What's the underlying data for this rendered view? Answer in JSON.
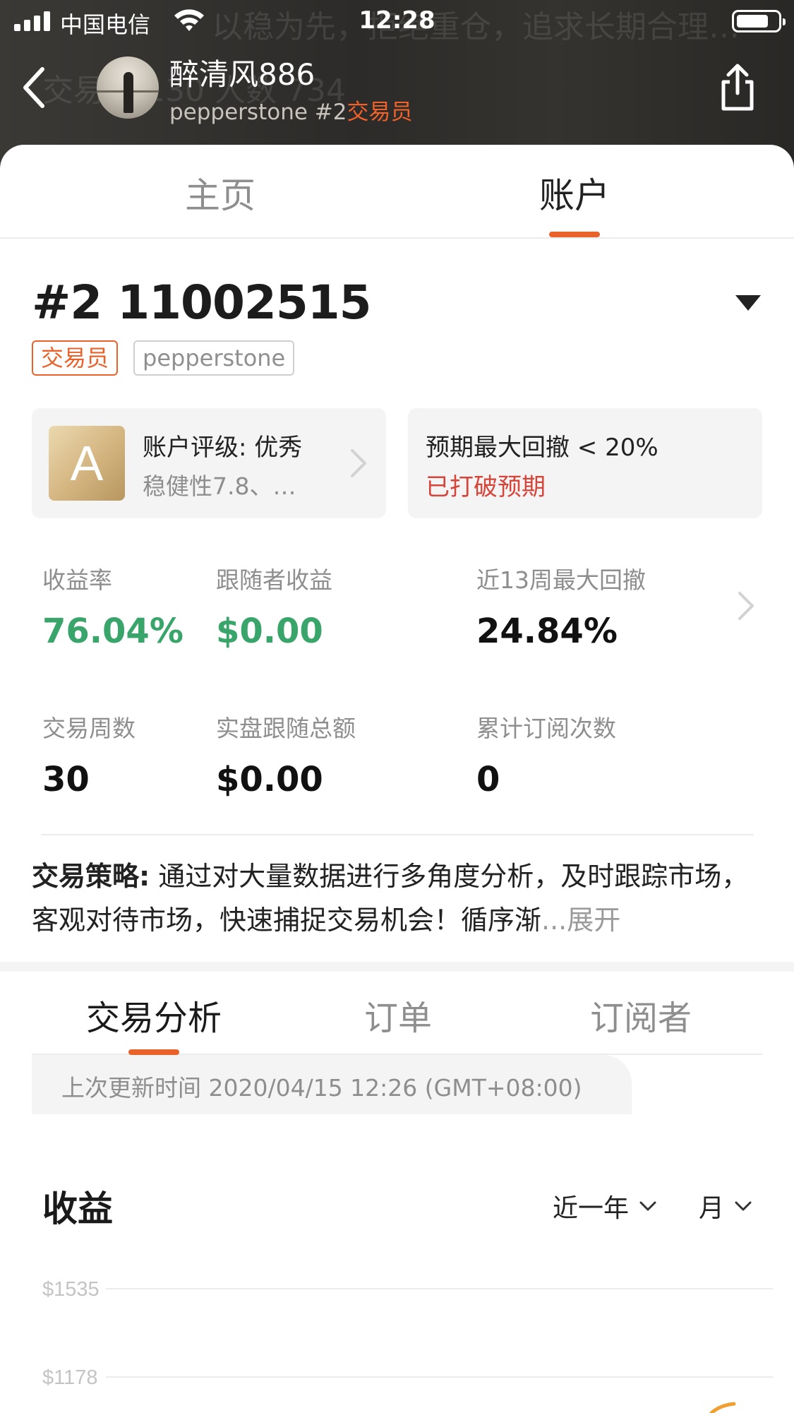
{
  "status_bar": {
    "carrier": "中国电信",
    "time": "12:28"
  },
  "header": {
    "user_name": "醉清风886",
    "broker": "pepperstone",
    "account_rank": "#2",
    "role": "交易员",
    "background_text": [
      "以稳为先，拒绝重仓，追求长期合理…",
      "交易量 130   人数 734"
    ]
  },
  "main_tabs": [
    {
      "label": "主页",
      "active": false
    },
    {
      "label": "账户",
      "active": true
    }
  ],
  "account": {
    "number": "#2 11002515",
    "badges": [
      "交易员",
      "pepperstone"
    ],
    "rating_card": {
      "grade": "A",
      "title": "账户评级: 优秀",
      "subtitle": "稳健性7.8、…"
    },
    "drawdown_card": {
      "title": "预期最大回撤 < 20%",
      "status": "已打破预期"
    },
    "stats": [
      {
        "label": "收益率",
        "value": "76.04%",
        "color": "#3aa56a"
      },
      {
        "label": "跟随者收益",
        "value": "$0.00",
        "color": "#3aa56a"
      },
      {
        "label": "近13周最大回撤",
        "value": "24.84%",
        "color": "#111111"
      },
      {
        "label": "交易周数",
        "value": "30",
        "color": "#111111"
      },
      {
        "label": "实盘跟随总额",
        "value": "$0.00",
        "color": "#111111"
      },
      {
        "label": "累计订阅次数",
        "value": "0",
        "color": "#111111"
      }
    ],
    "strategy": {
      "label": "交易策略:",
      "text": " 通过对大量数据进行多角度分析，及时跟踪市场，客观对待市场，快速捕捉交易机会！循序渐",
      "expand": "...展开"
    }
  },
  "sub_tabs": [
    {
      "label": "交易分析",
      "active": true
    },
    {
      "label": "订单",
      "active": false
    },
    {
      "label": "订阅者",
      "active": false
    }
  ],
  "update_time": "上次更新时间 2020/04/15 12:26 (GMT+08:00)",
  "earnings": {
    "title": "收益",
    "period": "近一年",
    "granularity": "月"
  },
  "chart_data": {
    "type": "line",
    "title": "收益",
    "y_ticks": [
      "$1535",
      "$1178"
    ],
    "y_tick_values": [
      1535,
      1178
    ],
    "series_color": "#f0a030",
    "grid": true
  },
  "colors": {
    "accent": "#e8622a",
    "positive": "#3aa56a",
    "warning": "#d6453a"
  }
}
